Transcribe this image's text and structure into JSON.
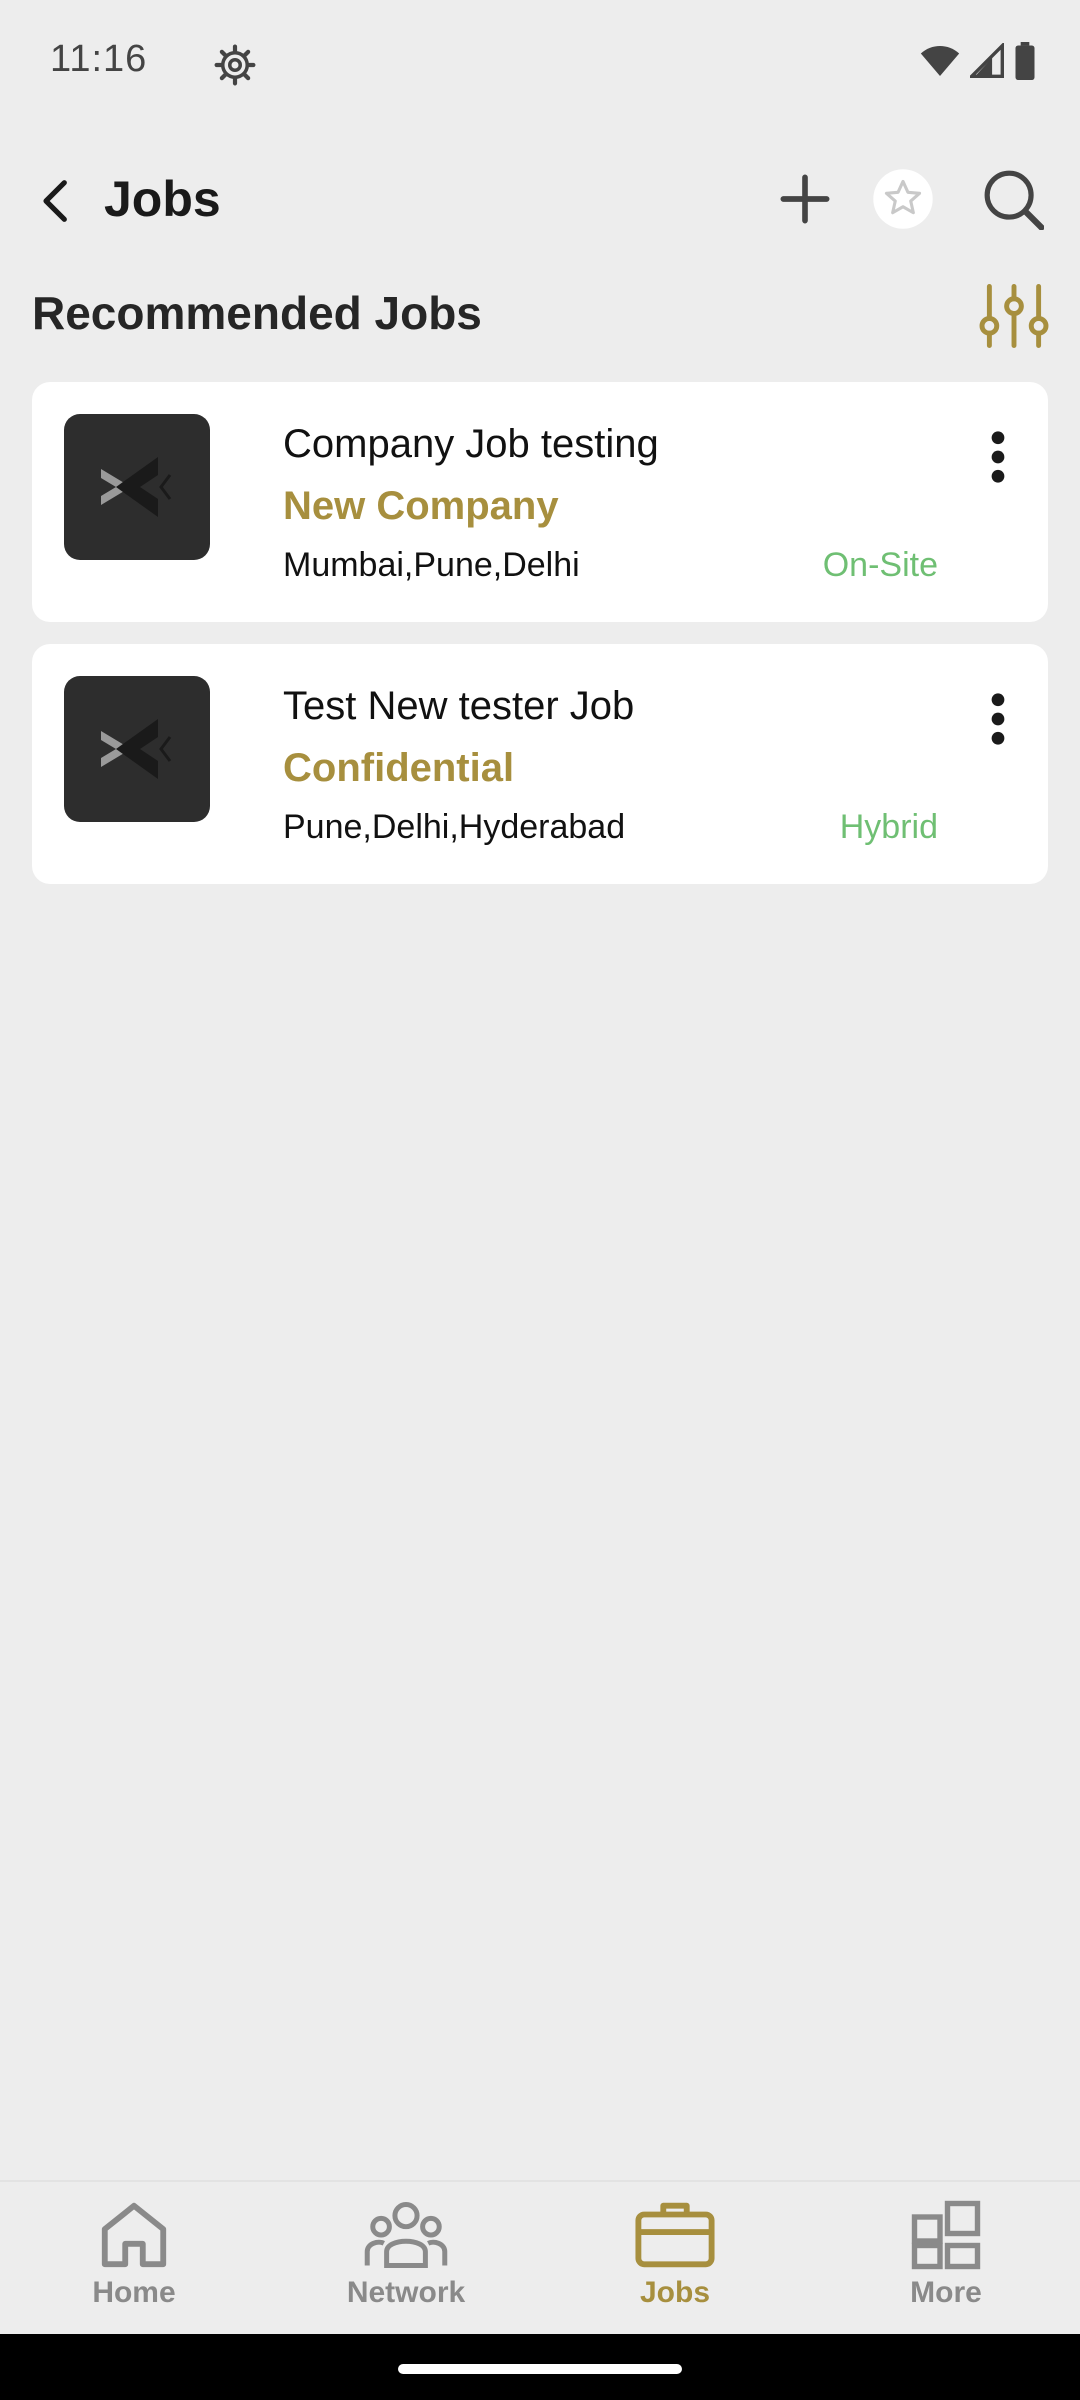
{
  "status_bar": {
    "time": "11:16"
  },
  "app_bar": {
    "title": "Jobs"
  },
  "section": {
    "title": "Recommended Jobs"
  },
  "jobs": [
    {
      "title": "Company Job testing",
      "company": "New Company",
      "locations": "Mumbai,Pune,Delhi",
      "work_mode": "On-Site"
    },
    {
      "title": "Test New tester Job",
      "company": "Confidential",
      "locations": "Pune,Delhi,Hyderabad",
      "work_mode": "Hybrid"
    }
  ],
  "bottom_nav": {
    "items": [
      {
        "label": "Home",
        "icon": "home-icon"
      },
      {
        "label": "Network",
        "icon": "network-icon"
      },
      {
        "label": "Jobs",
        "icon": "briefcase-icon",
        "active": true
      },
      {
        "label": "More",
        "icon": "grid-icon"
      }
    ]
  },
  "colors": {
    "accent": "#a78f3e",
    "work_mode": "#6fbf73",
    "background": "#ededed",
    "card": "#ffffff"
  }
}
